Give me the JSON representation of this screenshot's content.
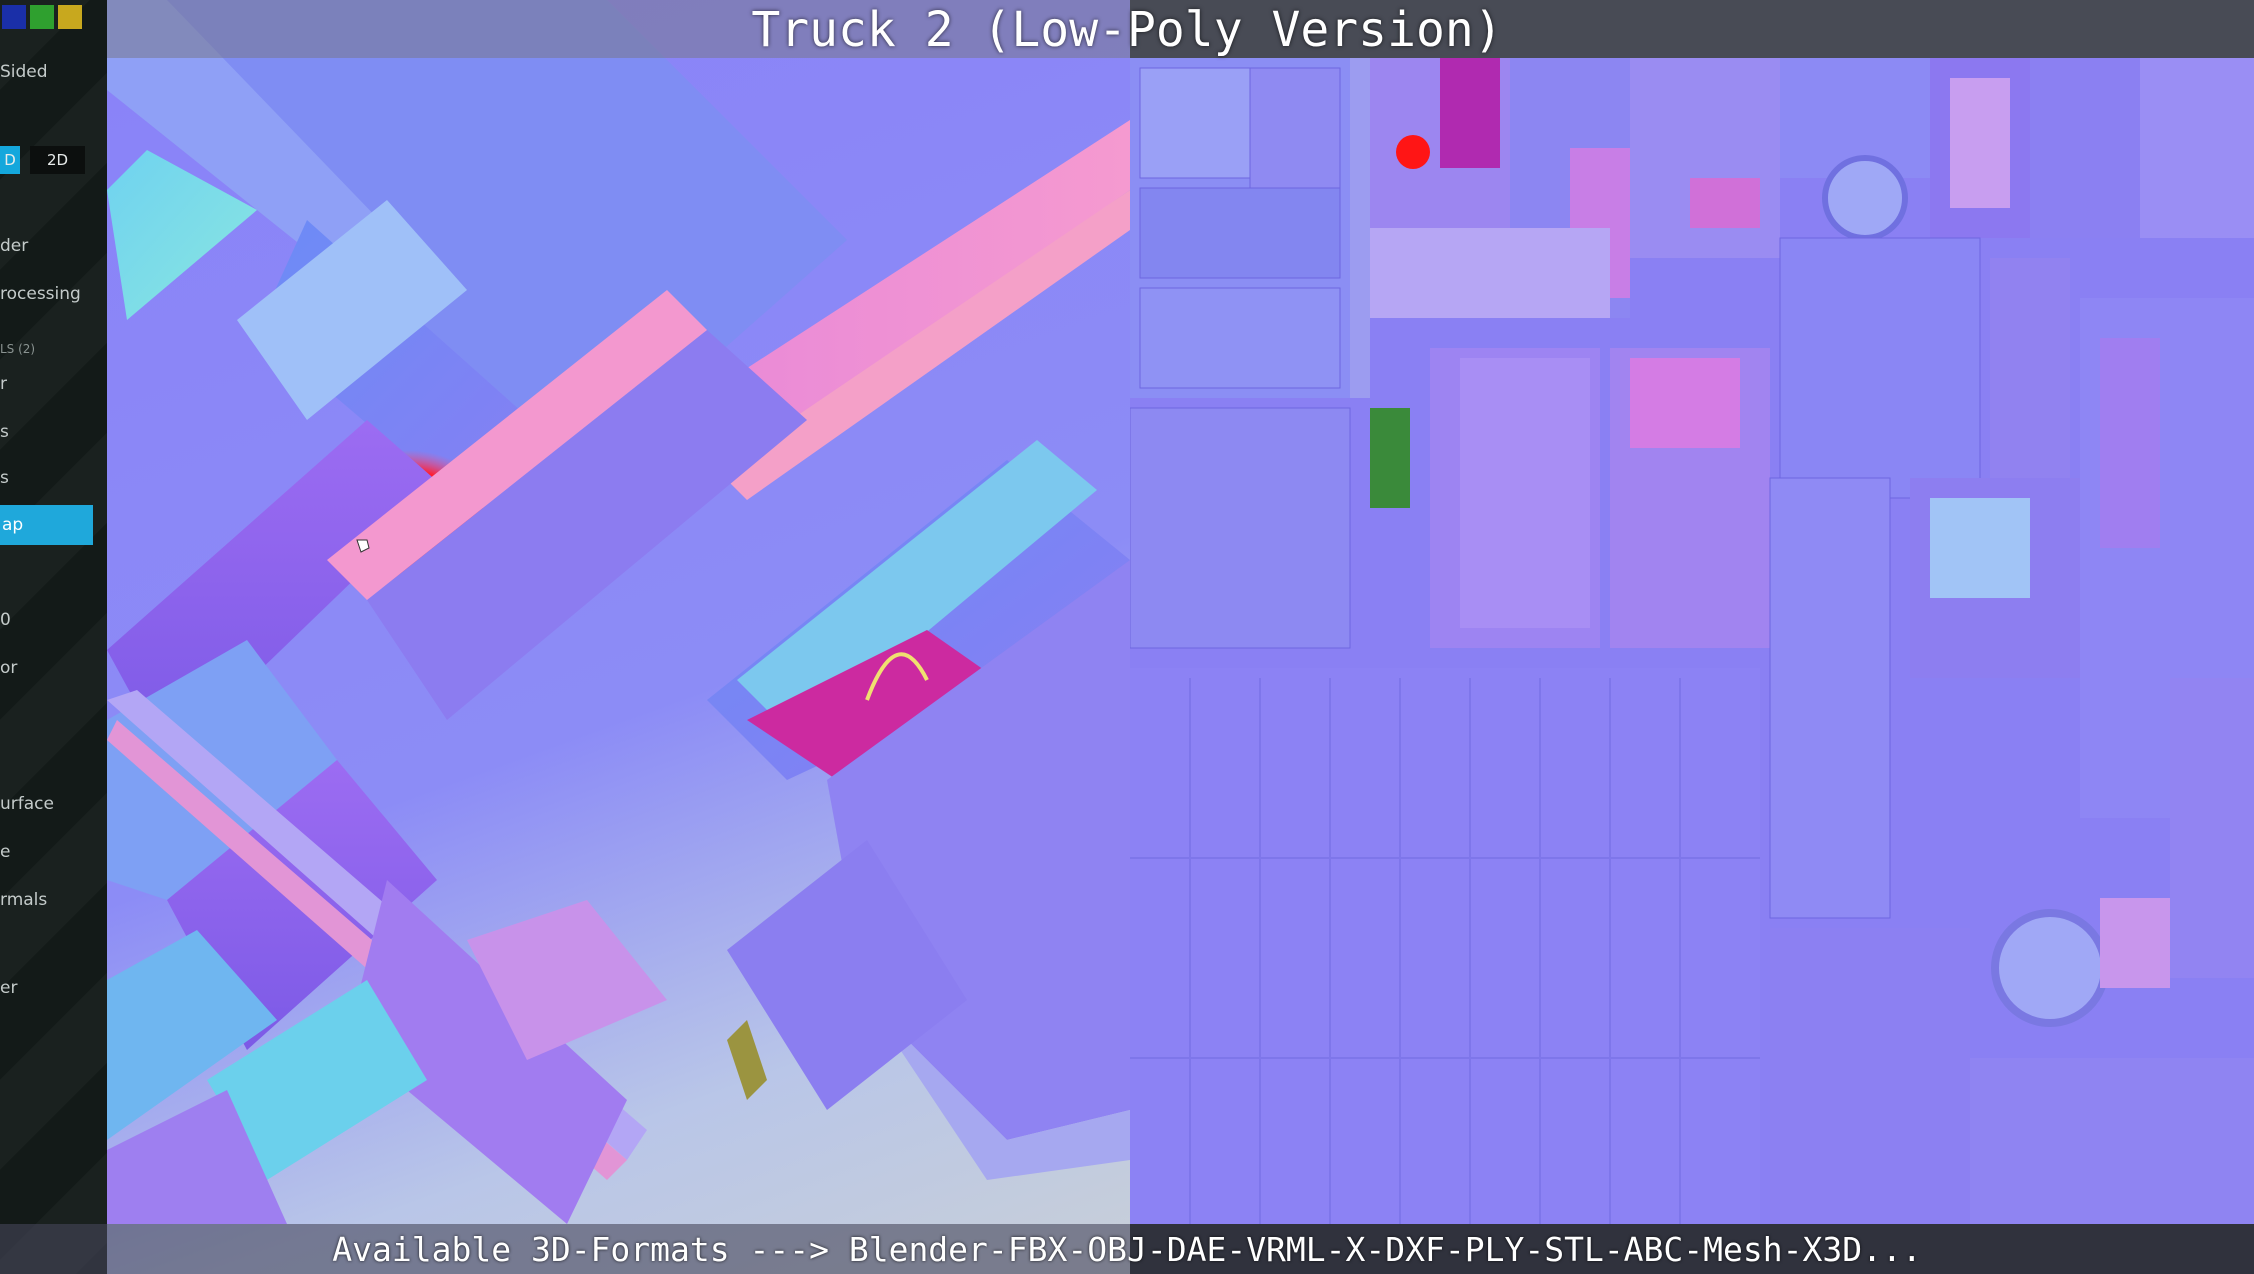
{
  "title": "Truck 2 (Low-Poly Version)",
  "footer": "Available 3D-Formats ---> Blender-FBX-OBJ-DAE-VRML-X-DXF-PLY-STL-ABC-Mesh-X3D...",
  "sidebar": {
    "color_swatches": [
      "#1a2fa8",
      "#2fa02f",
      "#c8a81e"
    ],
    "double_sided_label": "Sided",
    "mode_3d_label": "D",
    "mode_2d_label": "2D",
    "items": [
      {
        "label": "der"
      },
      {
        "label": "rocessing"
      },
      {
        "label": "LS (2)",
        "small": true
      },
      {
        "label": "r"
      },
      {
        "label": "s"
      },
      {
        "label": "s"
      }
    ],
    "active_item_label": "ap",
    "lower_items": [
      {
        "label": "0"
      },
      {
        "label": "or"
      },
      {
        "label": "urface"
      },
      {
        "label": "e"
      },
      {
        "label": "rmals"
      },
      {
        "label": "er"
      }
    ]
  },
  "viewport": {
    "marker_color": "#ff1a1a"
  },
  "texture": {
    "marker_color": "#ff1a1a",
    "base_color": "#8a80f3"
  }
}
